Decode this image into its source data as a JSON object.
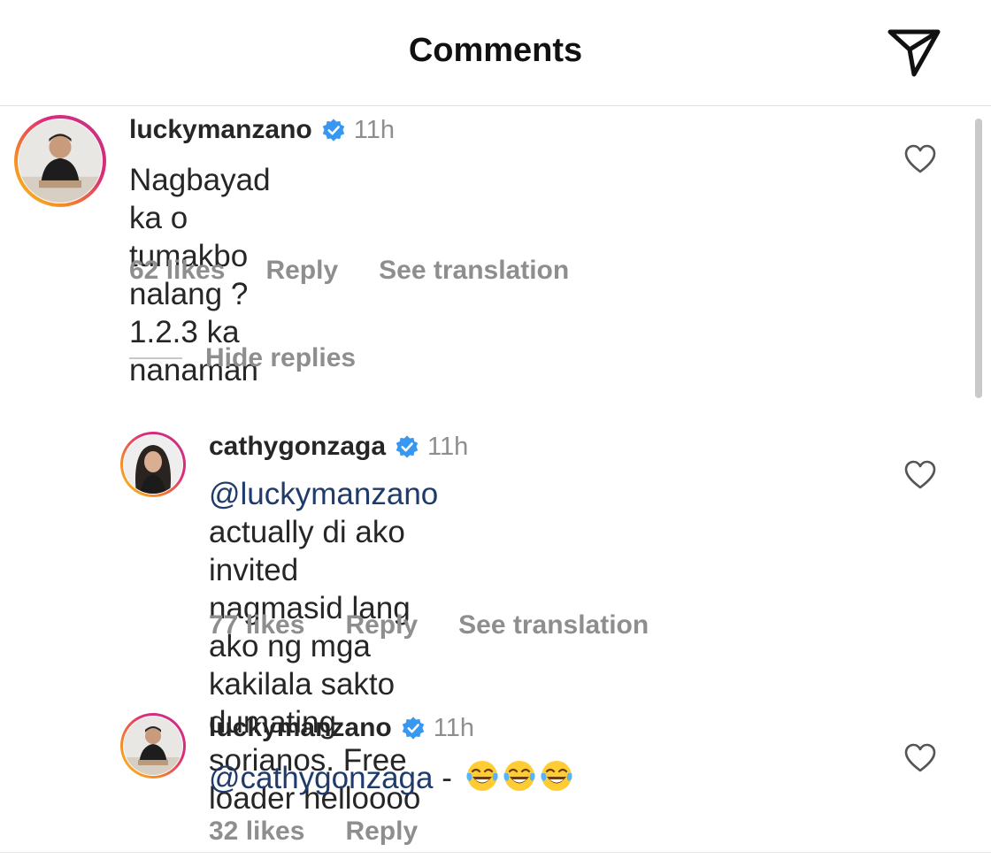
{
  "header": {
    "title": "Comments"
  },
  "comments": [
    {
      "username": "luckymanzano",
      "time": "11h",
      "text": "Nagbayad ka o tumakbo nalang ? 1.2.3 ka\nnanaman",
      "likes": "62 likes",
      "reply": "Reply",
      "translate": "See translation"
    }
  ],
  "hide_replies": "Hide replies",
  "replies": [
    {
      "username": "cathygonzaga",
      "time": "11h",
      "mention": "@luckymanzano",
      "text": " actually di ako invited\nnagmasid lang ako ng mga kakilala sakto\ndumating sorianos. Free loader helloooo",
      "likes": "77 likes",
      "reply": "Reply",
      "translate": "See translation"
    },
    {
      "username": "luckymanzano",
      "time": "11h",
      "mention": "@cathygonzaga",
      "text": " - ",
      "emojis": [
        "laughing-crying-emoji",
        "laughing-crying-emoji",
        "laughing-crying-emoji"
      ],
      "likes": "32 likes",
      "reply": "Reply"
    }
  ],
  "colors": {
    "mention": "#1f3b6b",
    "verified": "#3897f0",
    "muted": "#8e8e8e"
  }
}
